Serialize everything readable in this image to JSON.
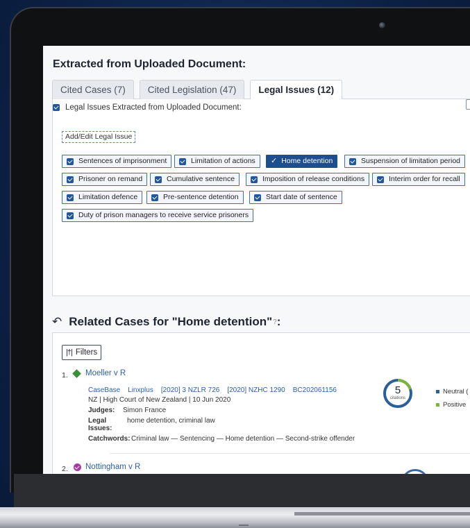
{
  "header": {
    "title": "Extracted from Uploaded Document:"
  },
  "tabs": [
    {
      "label": "Cited Cases (7)"
    },
    {
      "label": "Cited Legislation (47)"
    },
    {
      "label": "Legal Issues (12)",
      "active": true
    }
  ],
  "issues": {
    "heading": "Legal Issues Extracted from Uploaded Document:",
    "add_button": "Add/Edit Legal Issue",
    "chips": [
      {
        "label": "Sentences of imprisonment"
      },
      {
        "label": "Limitation of actions"
      },
      {
        "label": "Home detention",
        "selected": true
      },
      {
        "label": "Suspension of limitation period"
      },
      {
        "label": "Prisoner on remand"
      },
      {
        "label": "Cumulative sentence"
      },
      {
        "label": "Imposition of release conditions"
      },
      {
        "label": "Interim order for recall"
      },
      {
        "label": "Limitation defence"
      },
      {
        "label": "Pre-sentence detention"
      },
      {
        "label": "Start date of sentence"
      },
      {
        "label": "Duty of prison managers to receive service prisoners"
      }
    ]
  },
  "related": {
    "title": "Related Cases for \"Home detention\"",
    "suffix": ":",
    "filters_label": "Filters"
  },
  "cases": [
    {
      "number": "1.",
      "title": "Moeller v R",
      "sources": [
        "CaseBase",
        "Linxplus",
        "[2020] 3 NZLR 726",
        "[2020] NZHC 1290",
        "BC202061156"
      ],
      "court_line": "NZ | High Court of New Zealand | 10 Jun 2020",
      "judges_label": "Judges:",
      "judges": "Simon France",
      "issues_label": "Legal Issues:",
      "issues": "home detention, criminal law",
      "catchwords_label": "Catchwords:",
      "catchwords": "Criminal law — Sentencing — Home detention — Second-strike offender",
      "citations": {
        "count": "5",
        "label": "citations",
        "neutral_fraction": 0.8,
        "positive_fraction": 0.2
      },
      "legend": [
        {
          "label": "Neutral (",
          "color": "#2b5f9a"
        },
        {
          "label": "Positive",
          "color": "#7ab53c"
        }
      ]
    },
    {
      "number": "2.",
      "title": "Nottingham v R"
    }
  ],
  "colors": {
    "primary": "#1f4e8f",
    "link": "#2a5ea8",
    "positive": "#7ab53c",
    "neutral": "#2b5f9a"
  }
}
